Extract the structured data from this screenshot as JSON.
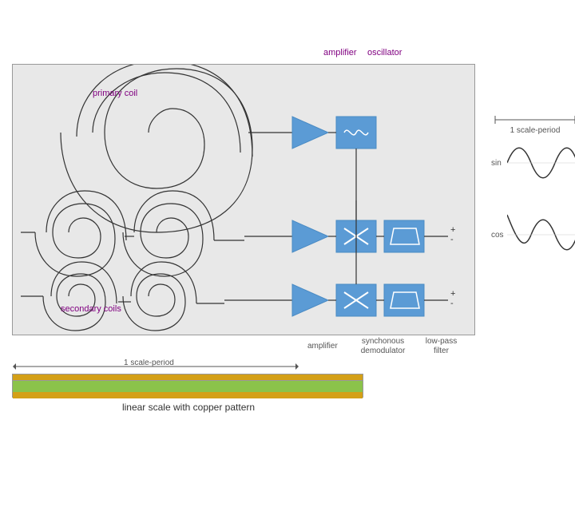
{
  "labels": {
    "amplifier": "amplifier",
    "oscillator": "oscillator",
    "primary_coil": "primary coil",
    "secondary_coils": "secondary coils",
    "amplifier2": "amplifier",
    "synchonous_demodulator": "synchonous\ndemodulator",
    "low_pass_filter": "low-pass\nfilter",
    "scale_period_right": "1 scale-period",
    "sin": "sin",
    "cos": "cos",
    "plus": "+",
    "minus": "-",
    "scale_period_bottom": "1 scale-period",
    "linear_scale": "linear scale with copper pattern"
  },
  "colors": {
    "blue": "#5b9bd5",
    "purple": "#800080",
    "gray_bg": "#e8e8e8",
    "green": "#8bc34a",
    "gold": "#d4a017"
  }
}
